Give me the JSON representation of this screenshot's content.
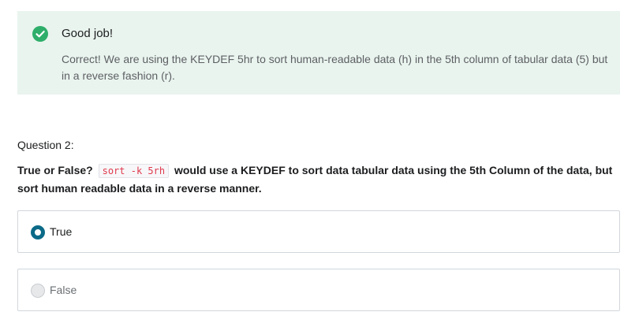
{
  "feedback": {
    "icon": "check-circle-icon",
    "color": "#2eae6a",
    "background": "#e9f4ee",
    "title": "Good job!",
    "message": "Correct! We are using the KEYDEF 5hr to sort human-readable data (h) in the 5th column of tabular data (5) but in a reverse fashion (r)."
  },
  "question": {
    "number_label": "Question 2:",
    "text_before": "True or False?",
    "code": "sort -k 5rh",
    "text_after": "would use a KEYDEF to sort data tabular data using the 5th Column of the data, but sort human readable data in a reverse manner."
  },
  "options": [
    {
      "label": "True",
      "selected": true
    },
    {
      "label": "False",
      "selected": false
    }
  ]
}
